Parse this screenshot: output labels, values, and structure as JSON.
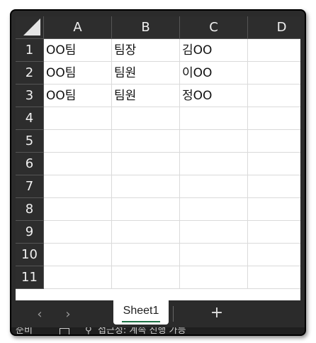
{
  "columns": [
    "A",
    "B",
    "C",
    "D"
  ],
  "rows": [
    "1",
    "2",
    "3",
    "4",
    "5",
    "6",
    "7",
    "8",
    "9",
    "10",
    "11"
  ],
  "cells": [
    [
      "OO팀",
      "팀장",
      "김OO",
      ""
    ],
    [
      "OO팀",
      "팀원",
      "이OO",
      ""
    ],
    [
      "OO팀",
      "팀원",
      "정OO",
      ""
    ]
  ],
  "tabs": {
    "prev_icon": "chevron-left-icon",
    "next_icon": "chevron-right-icon",
    "prev_glyph": "‹",
    "next_glyph": "›",
    "active_sheet": "Sheet1",
    "add_glyph": "+",
    "add_icon": "plus-icon"
  },
  "status": {
    "ready": "준비",
    "accessibility": "접근성: 계속 진행 가능",
    "sheet_icon": "sheet-view-icon",
    "accessibility_icon": "accessibility-icon"
  },
  "colors": {
    "header_bg": "#2d2d2d",
    "grid_line": "#dadada",
    "tab_underline": "#1e7145"
  }
}
